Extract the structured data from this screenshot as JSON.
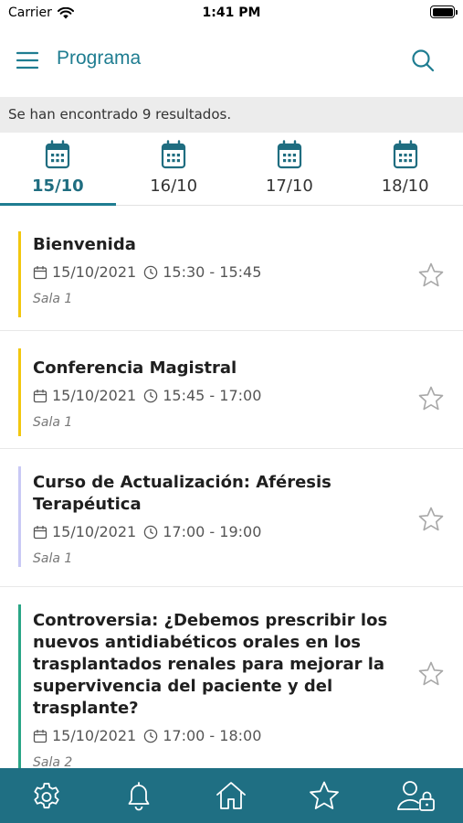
{
  "status_bar": {
    "carrier": "Carrier",
    "time": "1:41 PM"
  },
  "header": {
    "title": "Programa"
  },
  "results": {
    "text": "Se han encontrado 9 resultados."
  },
  "date_tabs": [
    {
      "label": "15/10",
      "active": true
    },
    {
      "label": "16/10",
      "active": false
    },
    {
      "label": "17/10",
      "active": false
    },
    {
      "label": "18/10",
      "active": false
    }
  ],
  "sessions": [
    {
      "title": "Bienvenida",
      "date": "15/10/2021",
      "time": "15:30 - 15:45",
      "room": "Sala 1",
      "accent": "#f2c70f"
    },
    {
      "title": "Conferencia Magistral",
      "date": "15/10/2021",
      "time": "15:45 - 17:00",
      "room": "Sala 1",
      "accent": "#f2c70f"
    },
    {
      "title": "Curso de Actualización: Aféresis Terapéutica",
      "date": "15/10/2021",
      "time": "17:00 - 19:00",
      "room": "Sala 1",
      "accent": "#c9c9f5"
    },
    {
      "title": "Controversia: ¿Debemos prescribir los nuevos antidiabéticos orales en los trasplantados renales para mejorar la supervivencia del paciente y del trasplante?",
      "date": "15/10/2021",
      "time": "17:00 - 18:00",
      "room": "Sala 2",
      "accent": "#2aa686"
    }
  ],
  "bottom_nav": [
    "gear-icon",
    "bell-icon",
    "home-icon",
    "star-icon",
    "user-lock-icon"
  ],
  "colors": {
    "brand": "#1f7d91",
    "nav_bg": "#1f6f83"
  }
}
